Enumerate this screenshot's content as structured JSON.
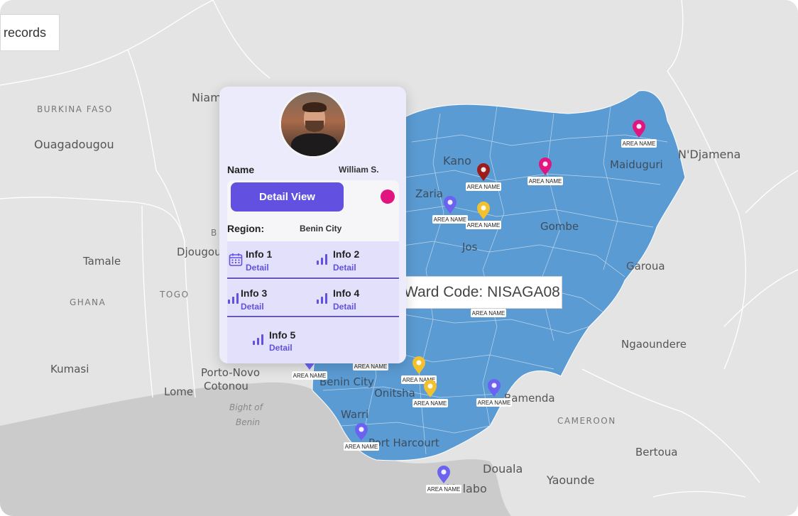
{
  "colors": {
    "map_land": "#e4e4e4",
    "country_fill": "#5b9bd3",
    "accent": "#6251e0",
    "status": "#e0157f"
  },
  "toolbar": {
    "records_label": "records"
  },
  "tooltip": {
    "ward_label": "Ward Code: NISAGA08"
  },
  "map_labels": {
    "burkina": "BURKINA FASO",
    "ouagadougou": "Ouagadougou",
    "niamey": "Niam",
    "tamale": "Tamale",
    "djougou": "Djougou",
    "togo": "TOGO",
    "ghana": "GHANA",
    "kumasi": "Kumasi",
    "lome": "Lome",
    "porto_novo": "Porto-Novo",
    "cotonou": "Cotonou",
    "bight1": "Bight of",
    "bight2": "Benin",
    "kano": "Kano",
    "zaria": "Zaria",
    "jos": "Jos",
    "gombe": "Gombe",
    "maiduguri": "Maiduguri",
    "ndjamena": "N'Djamena",
    "garoua": "Garoua",
    "ngaoundere": "Ngaoundere",
    "cameroon": "CAMEROON",
    "bamenda": "Bamenda",
    "benin_city": "Benin City",
    "onitsha": "Onitsha",
    "warri": "Warri",
    "port_harcourt": "Port Harcourt",
    "douala": "Douala",
    "yaounde": "Yaounde",
    "bertoua": "Bertoua",
    "malabo": "Malabo",
    "region_b": "B"
  },
  "markers": [
    {
      "label": "AREA NAME",
      "color": "#e0157f"
    },
    {
      "label": "AREA NAME",
      "color": "#9b1c1c"
    },
    {
      "label": "AREA NAME",
      "color": "#e0157f"
    },
    {
      "label": "AREA NAME",
      "color": "#6b63f0"
    },
    {
      "label": "AREA NAME",
      "color": "#f2c12e"
    },
    {
      "label": "AREA NAME",
      "color": "#f2c12e"
    },
    {
      "label": "AREA NAME",
      "color": "#f2c12e"
    },
    {
      "label": "AREA NAME",
      "color": "#6b63f0"
    },
    {
      "label": "AREA NAME",
      "color": "#f2c12e"
    },
    {
      "label": "AREA NAME",
      "color": "#6b63f0"
    },
    {
      "label": "AREA NAME",
      "color": "#6b63f0"
    },
    {
      "label": "AREA NAME",
      "color": "#6b63f0"
    },
    {
      "label": "AREA NAME",
      "color": "#6b63f0"
    }
  ],
  "card": {
    "name_label": "Name",
    "name_value": "William S.",
    "detail_button": "Detail View",
    "region_label": "Region:",
    "region_value": "Benin City",
    "infos": [
      {
        "title": "Info 1",
        "detail": "Detail",
        "icon": "calendar-icon"
      },
      {
        "title": "Info 2",
        "detail": "Detail",
        "icon": "bar-chart-icon"
      },
      {
        "title": "Info 3",
        "detail": "Detail",
        "icon": "bar-chart-icon"
      },
      {
        "title": "Info 4",
        "detail": "Detail",
        "icon": "bar-chart-icon"
      },
      {
        "title": "Info 5",
        "detail": "Detail",
        "icon": "bar-chart-icon"
      }
    ]
  }
}
